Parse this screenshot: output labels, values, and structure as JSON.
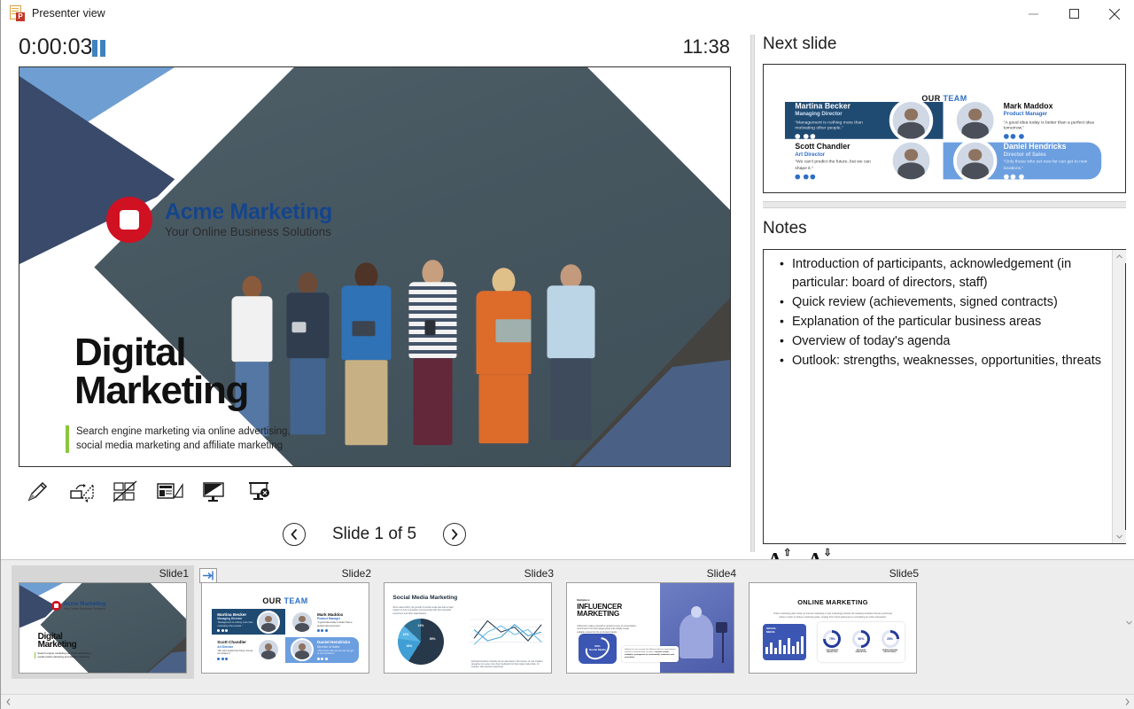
{
  "window": {
    "title": "Presenter view",
    "icon": "powerpoint-icon",
    "minimize": "minimize-icon",
    "maximize": "maximize-icon",
    "close": "close-icon"
  },
  "presenter": {
    "timer": "0:00:03",
    "pause_icon": "pause-icon",
    "clock": "11:38",
    "slide_counter": "Slide 1 of 5",
    "prev_icon": "chevron-left-icon",
    "next_icon": "chevron-right-icon",
    "tools": [
      {
        "name": "pen-tool-icon",
        "label": "Pen and laser pointer tools"
      },
      {
        "name": "pointer-options-icon",
        "label": "See all slides"
      },
      {
        "name": "zoom-slide-icon",
        "label": "Zoom into the slide"
      },
      {
        "name": "subtitles-icon",
        "label": "Toggle subtitles"
      },
      {
        "name": "black-screen-icon",
        "label": "Black or unblack slide show"
      },
      {
        "name": "end-show-icon",
        "label": "End slide show"
      }
    ]
  },
  "right_panel": {
    "next_slide_title": "Next slide",
    "notes_title": "Notes",
    "notes": [
      "Introduction of participants, acknowledgement (in particular: board of directors, staff)",
      "Quick review (achievements, signed contracts)",
      "Explanation of the particular business areas",
      "Overview of today's agenda",
      "Outlook: strengths, weaknesses, opportunities, threats"
    ],
    "font_larger": "A",
    "font_larger_arrow": "⇧",
    "font_smaller": "A",
    "font_smaller_arrow": "⇩",
    "scroll_up_icon": "scroll-up-icon",
    "scroll_down_icon": "scroll-down-icon"
  },
  "current_slide": {
    "logo_company": "Acme Marketing",
    "logo_tagline": "Your Online Business Solutions",
    "title_line1": "Digital",
    "title_line2": "Marketing",
    "subtitle_line1": "Search engine marketing via online advertising,",
    "subtitle_line2": "social media marketing and affiliate marketing",
    "colors": {
      "light_blue": "#6f9fd2",
      "navy": "#3a4a6b",
      "slate": "#4a6185",
      "dark_gray": "#454340",
      "logo_red": "#cf1122",
      "logo_blue": "#14458c",
      "accent_green": "#8cc63e"
    }
  },
  "next_slide": {
    "title_part1": "OUR ",
    "title_part2": "TEAM",
    "members": [
      {
        "name": "Martina Becker",
        "role": "Managing Director",
        "quote": "“Management is nothing more than motivating other people.”"
      },
      {
        "name": "Mark Maddox",
        "role": "Product Manager",
        "quote": "“A good idea today is better than a perfect idea tomorrow.”"
      },
      {
        "name": "Scott Chandler",
        "role": "Art Director",
        "quote": "“We can't predict the future, but we can shape it.”"
      },
      {
        "name": "Daniel Hendricks",
        "role": "Director of Sales",
        "quote": "“Only those who set new far can get to new locations.”"
      }
    ]
  },
  "filmstrip": {
    "goto_icon": "advance-slide-icon",
    "scroll_left_icon": "scroll-left-icon",
    "scroll_right_icon": "scroll-right-icon",
    "slides": [
      {
        "label": "Slide1",
        "selected": true
      },
      {
        "label": "Slide2",
        "selected": false
      },
      {
        "label": "Slide3",
        "selected": false
      },
      {
        "label": "Slide4",
        "selected": false
      },
      {
        "label": "Slide5",
        "selected": false
      }
    ],
    "slide3": {
      "title": "Social Media Marketing",
      "body": "Since about 2010, the growth of social media has had a major impact on how companies communicate with their potential customers and other stakeholders.",
      "pie_values": [
        "59%",
        "18%",
        "10%",
        "13%"
      ],
      "caption": "Individual products or brands can be advertised in this manner. At your smallest categories to receive more direct feedback from their target market than, for example, with television advertising."
    },
    "slide4": {
      "kicker": "Multipliers:",
      "title_line1": "INFLUENCER",
      "title_line2": "MARKETING",
      "body": "Influencers make a benefit or product a type of conversation, recommend it to their target group and usually create suitable content for the promoted brands.",
      "badge_value": "86%",
      "badge_label": "Social Media",
      "note": "Influencers can assume five different roles for organizations and their communication activities:",
      "note_bold": "content creator, multiplier, protagonist (or testimonial), moderator and consultant."
    },
    "slide5": {
      "title": "ONLINE MARKETING",
      "body": "Online marketing (also known as internet marketing or web marketing) includes all marketing activities that are performed online in order to achieve marketing goals, ranging from brand awareness to completing an online transaction.",
      "card_label_line1": "SOCIAL",
      "card_label_line2": "MEDIA",
      "donuts": [
        {
          "value": "75%",
          "label1": "INFLUENCER",
          "label2": "MARKETING"
        },
        {
          "value": "50%",
          "label1": "AFFILIATE",
          "label2": "MARKETING"
        },
        {
          "value": "25%",
          "label1": "SEARCH ENGINE",
          "label2": "ADVERTISING"
        }
      ]
    }
  }
}
